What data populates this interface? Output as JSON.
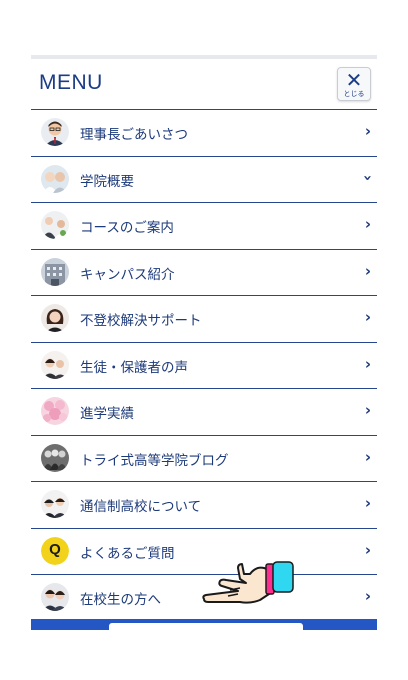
{
  "menu": {
    "title": "MENU",
    "close_label": "とじる",
    "items": [
      {
        "label": "理事長ごあいさつ",
        "arrow": "right"
      },
      {
        "label": "学院概要",
        "arrow": "down"
      },
      {
        "label": "コースのご案内",
        "arrow": "right"
      },
      {
        "label": "キャンパス紹介",
        "arrow": "right"
      },
      {
        "label": "不登校解決サポート",
        "arrow": "right"
      },
      {
        "label": "生徒・保護者の声",
        "arrow": "right"
      },
      {
        "label": "進学実績",
        "arrow": "right"
      },
      {
        "label": "トライ式高等学院ブログ",
        "arrow": "right"
      },
      {
        "label": "通信制高校について",
        "arrow": "right"
      },
      {
        "label": "よくあるご質問",
        "arrow": "right",
        "icon_text": "Q"
      },
      {
        "label": "在校生の方へ",
        "arrow": "right"
      }
    ]
  },
  "colors": {
    "primary": "#1d3a7a",
    "accent_blue": "#2456c4",
    "faq_yellow": "#f2d21b"
  }
}
